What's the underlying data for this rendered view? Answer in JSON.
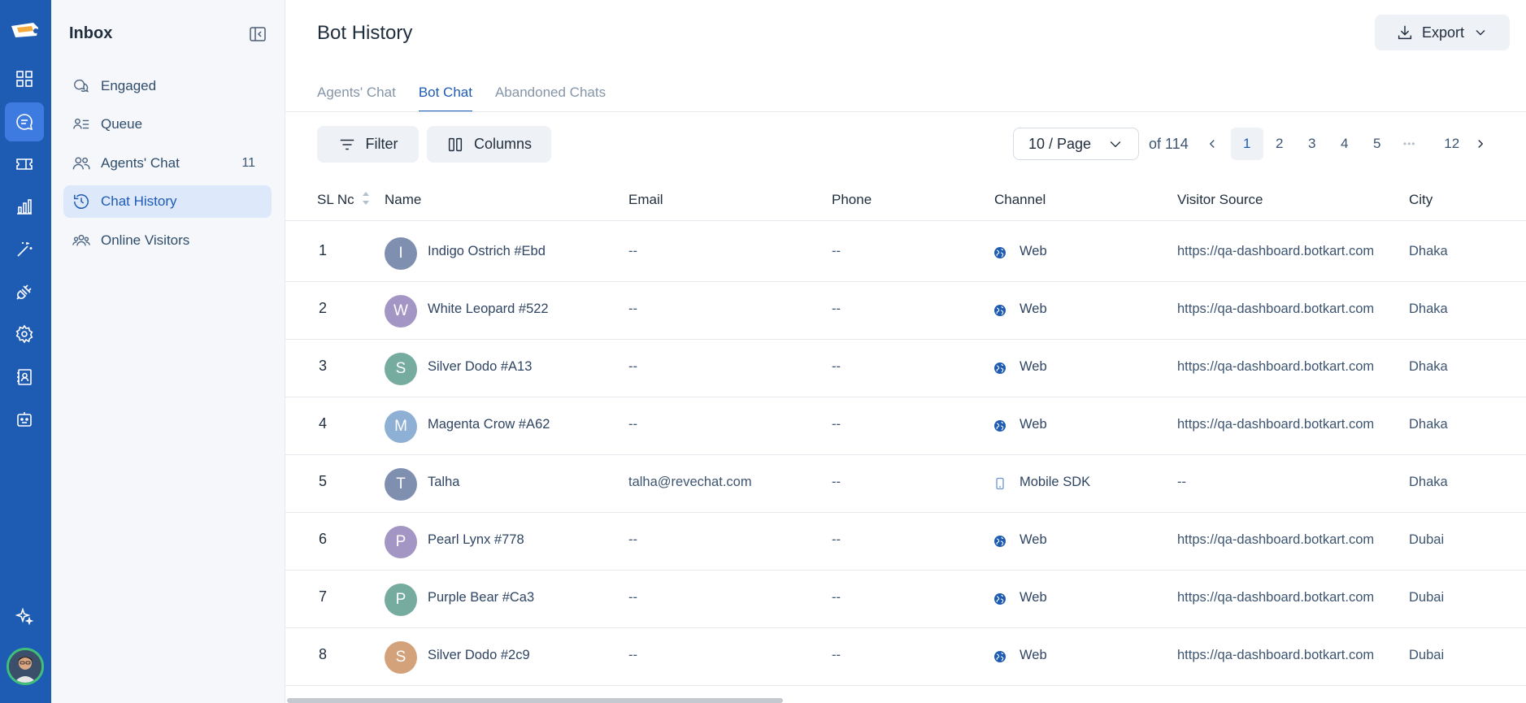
{
  "sidebar": {
    "title": "Inbox",
    "items": [
      {
        "label": "Engaged",
        "count": ""
      },
      {
        "label": "Queue",
        "count": ""
      },
      {
        "label": "Agents' Chat",
        "count": "11"
      },
      {
        "label": "Chat History",
        "count": ""
      },
      {
        "label": "Online Visitors",
        "count": ""
      }
    ]
  },
  "header": {
    "title": "Bot History",
    "export_label": "Export"
  },
  "tabs": [
    {
      "label": "Agents' Chat"
    },
    {
      "label": "Bot Chat"
    },
    {
      "label": "Abandoned Chats"
    }
  ],
  "toolbar": {
    "filter_label": "Filter",
    "columns_label": "Columns"
  },
  "pagination": {
    "page_size": "10 / Page",
    "total": "of 114",
    "pages": [
      "1",
      "2",
      "3",
      "4",
      "5"
    ],
    "ellipsis": "•••",
    "last": "12",
    "current": "1"
  },
  "table": {
    "headers": [
      "SL Nc",
      "Name",
      "Email",
      "Phone",
      "Channel",
      "Visitor Source",
      "City"
    ],
    "rows": [
      {
        "sl": "1",
        "initial": "I",
        "color": "#7f8fb0",
        "name": "Indigo Ostrich #Ebd",
        "email": "--",
        "phone": "--",
        "channel": "Web",
        "source": "https://qa-dashboard.botkart.com",
        "city": "Dhaka"
      },
      {
        "sl": "2",
        "initial": "W",
        "color": "#a395c4",
        "name": "White Leopard #522",
        "email": "--",
        "phone": "--",
        "channel": "Web",
        "source": "https://qa-dashboard.botkart.com",
        "city": "Dhaka"
      },
      {
        "sl": "3",
        "initial": "S",
        "color": "#76ab9f",
        "name": "Silver Dodo #A13",
        "email": "--",
        "phone": "--",
        "channel": "Web",
        "source": "https://qa-dashboard.botkart.com",
        "city": "Dhaka"
      },
      {
        "sl": "4",
        "initial": "M",
        "color": "#8eb0d4",
        "name": "Magenta Crow #A62",
        "email": "--",
        "phone": "--",
        "channel": "Web",
        "source": "https://qa-dashboard.botkart.com",
        "city": "Dhaka"
      },
      {
        "sl": "5",
        "initial": "T",
        "color": "#7f8fb0",
        "name": "Talha",
        "email": "talha@revechat.com",
        "phone": "--",
        "channel": "Mobile SDK",
        "source": "--",
        "city": "Dhaka"
      },
      {
        "sl": "6",
        "initial": "P",
        "color": "#a395c4",
        "name": "Pearl Lynx #778",
        "email": "--",
        "phone": "--",
        "channel": "Web",
        "source": "https://qa-dashboard.botkart.com",
        "city": "Dubai"
      },
      {
        "sl": "7",
        "initial": "P",
        "color": "#76ab9f",
        "name": "Purple Bear #Ca3",
        "email": "--",
        "phone": "--",
        "channel": "Web",
        "source": "https://qa-dashboard.botkart.com",
        "city": "Dubai"
      },
      {
        "sl": "8",
        "initial": "S",
        "color": "#d4a27a",
        "name": "Silver Dodo #2c9",
        "email": "--",
        "phone": "--",
        "channel": "Web",
        "source": "https://qa-dashboard.botkart.com",
        "city": "Dubai"
      }
    ]
  },
  "icons": {
    "rail": [
      "logo-icon",
      "dashboard-icon",
      "chat-icon",
      "ticket-icon",
      "analytics-icon",
      "magic-wand-icon",
      "plug-icon",
      "settings-icon",
      "contacts-icon",
      "bot-icon",
      "sparkle-icon"
    ]
  },
  "colors": {
    "brand": "#1e5bb3",
    "rail_active": "#3d7be0",
    "avatar_ring": "#3fbf7a"
  }
}
